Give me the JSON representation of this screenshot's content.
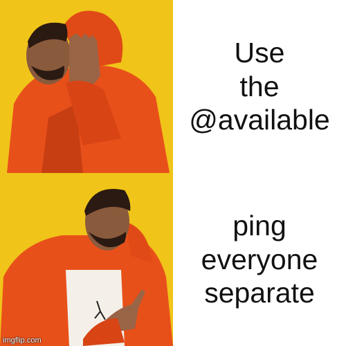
{
  "panels": [
    {
      "caption": "Use\nthe\n@available",
      "mood": "reject"
    },
    {
      "caption": "ping\neveryone\nseparate",
      "mood": "approve"
    }
  ],
  "watermark": "imgflip.com",
  "colors": {
    "background": "#f0c419",
    "jacket": "#e8501a",
    "jacket_shadow": "#b83410",
    "skin": "#8a5a3c",
    "text": "#111111"
  }
}
